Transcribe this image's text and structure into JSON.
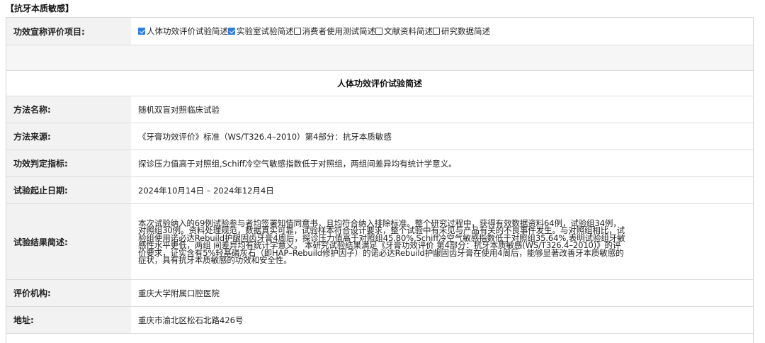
{
  "section_title": "【抗牙本质敏感】",
  "claim_row": {
    "label": "功效宣称评价项目:",
    "options": [
      {
        "label": "人体功效评价试验简述",
        "checked": true
      },
      {
        "label": "实验室试验简述",
        "checked": true
      },
      {
        "label": "消费者使用测试简述",
        "checked": false
      },
      {
        "label": "文献资料简述",
        "checked": false
      },
      {
        "label": "研究数据简述",
        "checked": false
      }
    ]
  },
  "heading": "人体功效评价试验简述",
  "rows": [
    {
      "label": "方法名称:",
      "value": "随机双盲对照临床试验"
    },
    {
      "label": "方法来源:",
      "value": "《牙膏功效评价》标准（WS/T326.4–2010）第4部分：抗牙本质敏感"
    },
    {
      "label": "功效判定指标:",
      "value": "探诊压力值高于对照组,Schiff冷空气敏感指数低于对照组，两组间差异均有统计学意义。"
    },
    {
      "label": "试验起止日期:",
      "value": "2024年10月14日 – 2024年12月4日"
    },
    {
      "label": "试验结果简述:",
      "value": "本次试验纳入的69例试验参与者均签署知情同意书，且均符合纳入排除标准。整个研究过程中，获得有效数据资料64例，试验组34例，对照组30例。资料处理规范，数据真实可靠，试验样本符合设计要求，整个试验中有未见与产品有关的不良事件发生。与对照组相比，试验组使用诺必达Rebuild护龈固齿牙膏4周后，探诊压力值高于对照组45.80%,Schiff冷空气敏感指数低于对照组35.64%,表明试验组牙敏感性水平更低，两组 间差异均有统计学意义。 本研究试验结果满足《牙膏功效评价 第4部分：抗牙本质敏感(WS/T326.4–2010)》的评价要求，证实含有5%轻基磷灰石（即HAP–Rebuild修护因子）的诺必达Rebuild护龈固齿牙膏在使用4周后，能够显著改善牙本质敏感的症状，具有抗牙本质敏感的功效和安全性。"
    },
    {
      "label": "评价机构:",
      "value": "重庆大学附属口腔医院"
    },
    {
      "label": "地址:",
      "value": "重庆市渝北区松石北路426号"
    }
  ],
  "colors": {
    "checkbox_checked": "#2f7de1",
    "label_bg": "#f2f2f2",
    "border": "#dcdcdc"
  }
}
